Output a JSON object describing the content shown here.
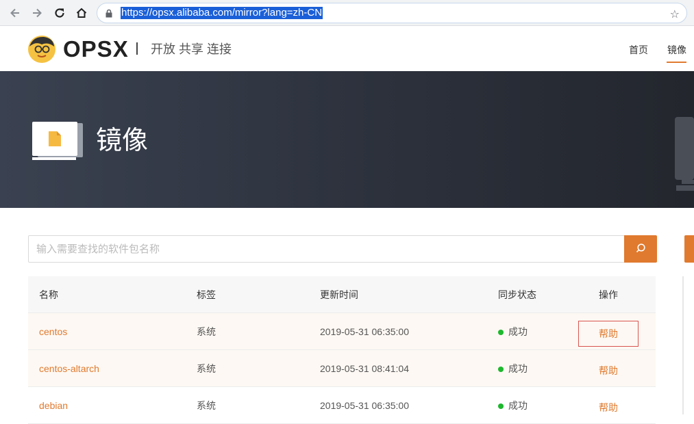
{
  "browser": {
    "url": "https://opsx.alibaba.com/mirror?lang=zh-CN",
    "back_icon": "arrow-left-icon",
    "forward_icon": "arrow-right-icon",
    "reload_icon": "reload-icon",
    "home_icon": "home-icon",
    "lock_icon": "lock-icon",
    "bookmark_icon": "star-icon"
  },
  "header": {
    "logo_text": "OPSX",
    "slogan": "开放 共享 连接",
    "nav": [
      {
        "label": "首页",
        "active": false
      },
      {
        "label": "镜像",
        "active": true
      }
    ]
  },
  "banner": {
    "title": "镜像"
  },
  "search": {
    "placeholder": "输入需要查找的软件包名称",
    "value": ""
  },
  "table": {
    "headers": [
      "名称",
      "标签",
      "更新时间",
      "同步状态",
      "操作"
    ],
    "rows": [
      {
        "name": "centos",
        "tag": "系统",
        "updated": "2019-05-31 06:35:00",
        "status": "成功",
        "action": "帮助"
      },
      {
        "name": "centos-altarch",
        "tag": "系统",
        "updated": "2019-05-31 08:41:04",
        "status": "成功",
        "action": "帮助"
      },
      {
        "name": "debian",
        "tag": "系统",
        "updated": "2019-05-31 06:35:00",
        "status": "成功",
        "action": "帮助"
      }
    ]
  },
  "colors": {
    "accent": "#e07a2e",
    "success": "#1db82d",
    "banner_dark": "#2c313c"
  }
}
